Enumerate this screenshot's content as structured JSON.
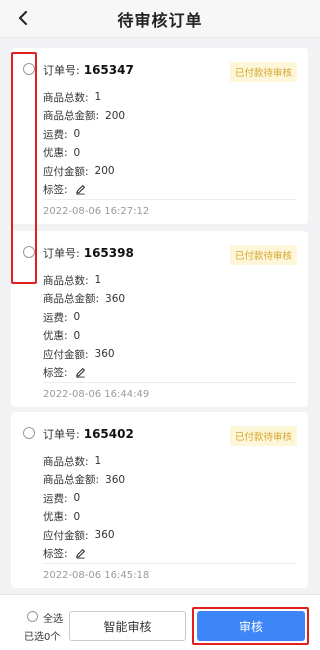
{
  "header": {
    "title": "待审核订单"
  },
  "labels": {
    "order_no": "订单号:",
    "total_qty": "商品总数:",
    "total_amount": "商品总金额:",
    "shipping": "运费:",
    "discount": "优惠:",
    "payable": "应付金额:",
    "tag": "标签:"
  },
  "orders": [
    {
      "order_no": "165347",
      "status": "已付款待审核",
      "total_qty": "1",
      "total_amount": "200",
      "shipping": "0",
      "discount": "0",
      "payable": "200",
      "time": "2022-08-06 16:27:12"
    },
    {
      "order_no": "165398",
      "status": "已付款待审核",
      "total_qty": "1",
      "total_amount": "360",
      "shipping": "0",
      "discount": "0",
      "payable": "360",
      "time": "2022-08-06 16:44:49"
    },
    {
      "order_no": "165402",
      "status": "已付款待审核",
      "total_qty": "1",
      "total_amount": "360",
      "shipping": "0",
      "discount": "0",
      "payable": "360",
      "time": "2022-08-06 16:45:18"
    }
  ],
  "footer": {
    "select_all": "全选",
    "selected_count": "已选0个",
    "smart_review": "智能审核",
    "review": "审核"
  },
  "colors": {
    "accent": "#3e86f7",
    "badge_bg": "#fdf6d8",
    "badge_text": "#d7a62f",
    "highlight": "#e02020"
  },
  "icons": {
    "back": "chevron-left-icon",
    "tag_edit": "pencil-icon"
  }
}
